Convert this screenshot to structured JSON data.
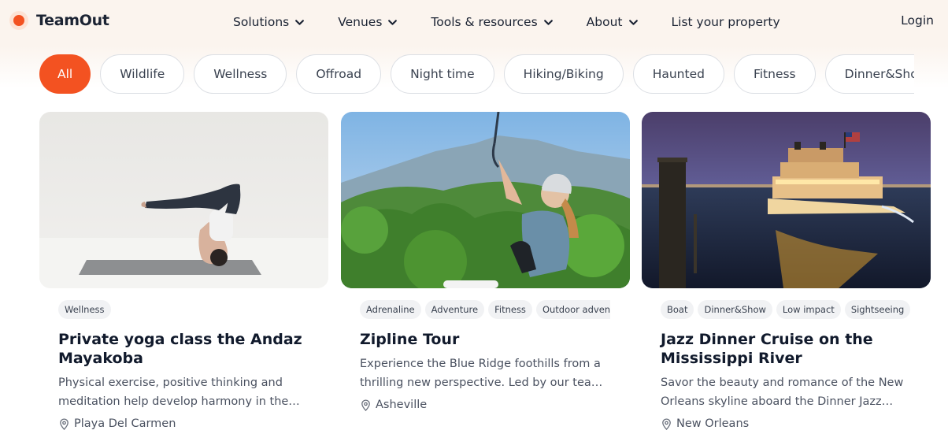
{
  "brand": {
    "name": "TeamOut",
    "accent": "#f35221"
  },
  "nav": {
    "items": [
      {
        "label": "Solutions",
        "has_dropdown": true
      },
      {
        "label": "Venues",
        "has_dropdown": true
      },
      {
        "label": "Tools & resources",
        "has_dropdown": true
      },
      {
        "label": "About",
        "has_dropdown": true
      },
      {
        "label": "List your property",
        "has_dropdown": false
      }
    ],
    "login": "Login"
  },
  "filters": {
    "selected": "All",
    "items": [
      "All",
      "Wildlife",
      "Wellness",
      "Offroad",
      "Night time",
      "Hiking/Biking",
      "Haunted",
      "Fitness",
      "Dinner&Show"
    ]
  },
  "cards": [
    {
      "tags": [
        "Wellness"
      ],
      "title": "Private yoga class the Andaz Mayakoba",
      "description": "Physical exercise, positive thinking and meditation help develop harmony in the…",
      "location": "Playa Del Carmen",
      "image_icon": "yoga-photo"
    },
    {
      "tags": [
        "Adrenaline",
        "Adventure",
        "Fitness",
        "Outdoor advent"
      ],
      "title": "Zipline Tour",
      "description": "Experience the Blue Ridge foothills from a thrilling new perspective. Led by our tea…",
      "location": "Asheville",
      "image_icon": "zipline-photo"
    },
    {
      "tags": [
        "Boat",
        "Dinner&Show",
        "Low impact",
        "Sightseeing"
      ],
      "title": "Jazz Dinner Cruise on the Mississippi River",
      "description": "Savor the beauty and romance of the New Orleans skyline aboard the Dinner Jazz…",
      "location": "New Orleans",
      "image_icon": "riverboat-photo"
    }
  ]
}
